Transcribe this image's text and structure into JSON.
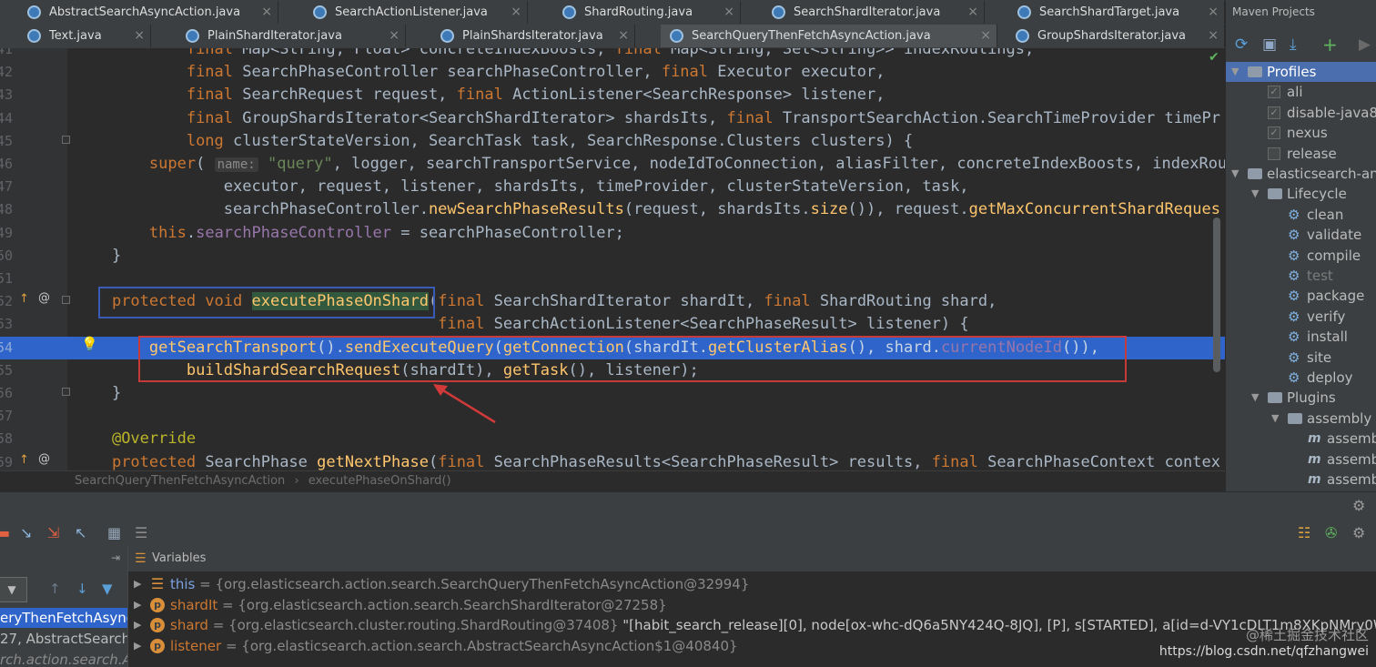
{
  "tabs_row1": [
    {
      "label": "AbstractSearchAsyncAction.java",
      "active": false
    },
    {
      "label": "SearchActionListener.java",
      "active": false
    },
    {
      "label": "ShardRouting.java",
      "active": false
    },
    {
      "label": "SearchShardIterator.java",
      "active": false
    },
    {
      "label": "SearchShardTarget.java",
      "active": false
    }
  ],
  "tabs_row2": [
    {
      "label": "Text.java",
      "active": false
    },
    {
      "label": "PlainShardIterator.java",
      "active": false
    },
    {
      "label": "PlainShardsIterator.java",
      "active": false
    },
    {
      "label": "SearchQueryThenFetchAsyncAction.java",
      "active": true
    },
    {
      "label": "GroupShardsIterator.java",
      "active": false
    }
  ],
  "editor": {
    "lines": [
      {
        "num": "41",
        "html": "            <span class=\"kw\">final</span> Map&lt;String, Float&gt; concreteIndexBoosts, <span class=\"kw\">final</span> Map&lt;String, Set&lt;String&gt;&gt; indexRoutings,"
      },
      {
        "num": "42",
        "html": "            <span class=\"kw\">final</span> SearchPhaseController searchPhaseController, <span class=\"kw\">final</span> Executor executor,"
      },
      {
        "num": "43",
        "html": "            <span class=\"kw\">final</span> SearchRequest request, <span class=\"kw\">final</span> ActionListener&lt;SearchResponse&gt; listener,"
      },
      {
        "num": "44",
        "html": "            <span class=\"kw\">final</span> GroupShardsIterator&lt;SearchShardIterator&gt; shardsIts, <span class=\"kw\">final</span> TransportSearchAction.SearchTimeProvider timePr"
      },
      {
        "num": "45",
        "html": "            <span class=\"kw\">long</span> clusterStateVersion, SearchTask task, SearchResponse.Clusters clusters) {"
      },
      {
        "num": "46",
        "html": "        <span class=\"kw\">super</span>( <span class=\"hint\">name:</span> <span class=\"str\">\"query\"</span>, logger, searchTransportService, nodeIdToConnection, aliasFilter, concreteIndexBoosts, indexRout"
      },
      {
        "num": "47",
        "html": "                executor, request, listener, shardsIts, timeProvider, clusterStateVersion, task,"
      },
      {
        "num": "48",
        "html": "                searchPhaseController.<span class=\"fn\">newSearchPhaseResults</span>(request, shardsIts.<span class=\"fn\">size</span>()), request.<span class=\"fn\">getMaxConcurrentShardReques</span>"
      },
      {
        "num": "49",
        "html": "        <span class=\"kw\">this</span>.<span class=\"fld\">searchPhaseController</span> = searchPhaseController;"
      },
      {
        "num": "50",
        "html": "    }"
      },
      {
        "num": "51",
        "html": ""
      },
      {
        "num": "52",
        "html": "    <span class=\"kw\">protected void</span> <span class=\"methhl\">executePhaseOnShard</span>(<span class=\"kw\">final</span> SearchShardIterator shardIt, <span class=\"kw\">final</span> ShardRouting shard,"
      },
      {
        "num": "53",
        "html": "                                       <span class=\"kw\">final</span> SearchActionListener&lt;SearchPhaseResult&gt; listener) {"
      },
      {
        "num": "54",
        "html": "        <span class=\"fn\">getSearchTransport</span>().<span class=\"fn\">sendExecuteQuery</span>(<span class=\"fn\">getConnection</span>(shardIt.<span class=\"fn\">getClusterAlias</span>(), shard.<span class=\"fld\">currentNodeId</span>()),"
      },
      {
        "num": "55",
        "html": "            <span class=\"fn\">buildShardSearchRequest</span>(shardIt), <span class=\"fn\">getTask</span>(), listener);"
      },
      {
        "num": "56",
        "html": "    }"
      },
      {
        "num": "57",
        "html": ""
      },
      {
        "num": "58",
        "html": "    <span class=\"ann\">@Override</span>"
      },
      {
        "num": "59",
        "html": "    <span class=\"kw\">protected</span> SearchPhase <span class=\"fn\">getNextPhase</span>(<span class=\"kw\">final</span> SearchPhaseResults&lt;SearchPhaseResult&gt; results, <span class=\"kw\">final</span> SearchPhaseContext contex"
      }
    ]
  },
  "breadcrumb": {
    "class": "SearchQueryThenFetchAsyncAction",
    "sep": "›",
    "method": "executePhaseOnShard()"
  },
  "maven": {
    "title": "Maven Projects",
    "profiles_label": "Profiles",
    "profiles": [
      {
        "label": "ali",
        "checked": true
      },
      {
        "label": "disable-java8",
        "checked": true
      },
      {
        "label": "nexus",
        "checked": true
      },
      {
        "label": "release",
        "checked": false
      }
    ],
    "project_label": "elasticsearch-an",
    "lifecycle_label": "Lifecycle",
    "lifecycle": [
      "clean",
      "validate",
      "compile",
      "test",
      "package",
      "verify",
      "install",
      "site",
      "deploy"
    ],
    "plugins_label": "Plugins",
    "plugin": "assembly",
    "goals": [
      "assemb",
      "assemb",
      "assemb"
    ]
  },
  "debug": {
    "variables_label": "Variables",
    "frames": [
      {
        "label": "eryThenFetchAsync",
        "selected": true
      },
      {
        "label": "27, AbstractSearchA",
        "selected": false
      },
      {
        "label": "rch.action.search.Al",
        "selected": false
      }
    ],
    "variables": [
      {
        "name": "this",
        "value": "= {org.elasticsearch.action.search.SearchQueryThenFetchAsyncAction@32994}",
        "extra": ""
      },
      {
        "name": "shardIt",
        "value": "= {org.elasticsearch.action.search.SearchShardIterator@27258}",
        "extra": ""
      },
      {
        "name": "shard",
        "value": "= {org.elasticsearch.cluster.routing.ShardRouting@37408}",
        "extra": "\"[habit_search_release][0], node[ox-whc-dQ6a5NY424Q-8JQ], [P], s[STARTED], a[id=d-VY1cDLT1m8XKpNMry0Wg]\""
      },
      {
        "name": "listener",
        "value": "= {org.elasticsearch.action.search.AbstractSearchAsyncAction$1@40840}",
        "extra": ""
      }
    ]
  },
  "watermark": {
    "line1": "@稀土掘金技术社区",
    "line2": "https://blog.csdn.net/qfzhangwei"
  }
}
